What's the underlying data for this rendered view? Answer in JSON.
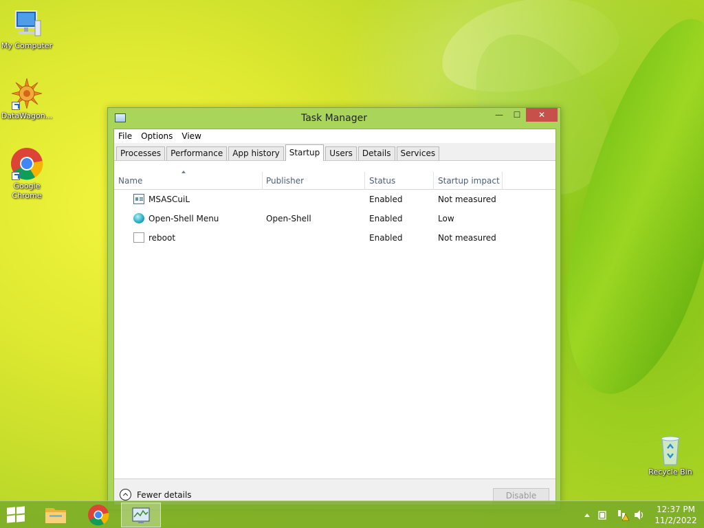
{
  "desktop": {
    "icons": [
      {
        "label": "My Computer"
      },
      {
        "label": "DataWagon..."
      },
      {
        "label": "Google Chrome"
      },
      {
        "label": "Recycle Bin"
      }
    ]
  },
  "window": {
    "title": "Task Manager",
    "controls": {
      "minimize": "—",
      "maximize": "☐",
      "close": "✕"
    },
    "menu": [
      "File",
      "Options",
      "View"
    ],
    "tabs": [
      "Processes",
      "Performance",
      "App history",
      "Startup",
      "Users",
      "Details",
      "Services"
    ],
    "active_tab": "Startup",
    "columns": {
      "name": "Name",
      "publisher": "Publisher",
      "status": "Status",
      "impact": "Startup impact"
    },
    "rows": [
      {
        "name": "MSASCuiL",
        "publisher": "",
        "status": "Enabled",
        "impact": "Not measured",
        "icon": "defender-window-icon"
      },
      {
        "name": "Open-Shell Menu",
        "publisher": "Open-Shell",
        "status": "Enabled",
        "impact": "Low",
        "icon": "open-shell-icon"
      },
      {
        "name": "reboot",
        "publisher": "",
        "status": "Enabled",
        "impact": "Not measured",
        "icon": "blank-file-icon"
      }
    ],
    "footer": {
      "fewer_details": "Fewer details",
      "disable": "Disable"
    }
  },
  "taskbar": {
    "apps": [
      "start-icon",
      "file-explorer-icon",
      "chrome-icon",
      "task-manager-icon"
    ],
    "clock": {
      "time": "12:37 PM",
      "date": "11/2/2022"
    }
  }
}
